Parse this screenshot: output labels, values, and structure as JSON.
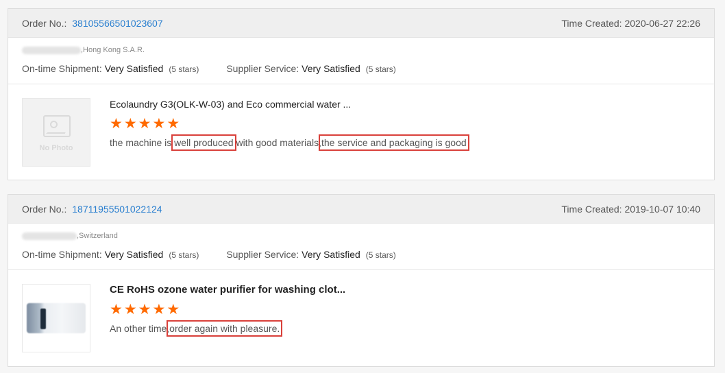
{
  "orders": [
    {
      "order_label": "Order No.:",
      "order_number": "38105566501023607",
      "time_created": "Time Created: 2020-06-27 22:26",
      "buyer_location": ",Hong Kong S.A.R.",
      "shipment_label": "On-time Shipment:",
      "shipment_value": "Very Satisfied",
      "shipment_stars": "(5 stars)",
      "supplier_label": "Supplier Service:",
      "supplier_value": "Very Satisfied",
      "supplier_stars": "(5 stars)",
      "product_title": "Ecolaundry G3(OLK-W-03) and Eco commercial water ...",
      "thumbnail_text": "No Photo",
      "rating": 5,
      "review_parts": [
        "the machine is ",
        "well produced",
        " with good materials,",
        "the service and packaging is good"
      ]
    },
    {
      "order_label": "Order No.:",
      "order_number": "18711955501022124",
      "time_created": "Time Created: 2019-10-07 10:40",
      "buyer_location": ",Switzerland",
      "shipment_label": "On-time Shipment:",
      "shipment_value": "Very Satisfied",
      "shipment_stars": "(5 stars)",
      "supplier_label": "Supplier Service:",
      "supplier_value": "Very Satisfied",
      "supplier_stars": "(5 stars)",
      "product_title": "CE RoHS ozone water purifier for washing clot...",
      "rating": 5,
      "review_parts": [
        "An other time,",
        "order again with pleasure."
      ]
    }
  ],
  "colors": {
    "link": "#2a7fcf",
    "star": "#ff6a00",
    "highlight_box": "#d9403a"
  },
  "icons": {
    "star": "star-icon",
    "no_photo": "image-placeholder-icon"
  }
}
